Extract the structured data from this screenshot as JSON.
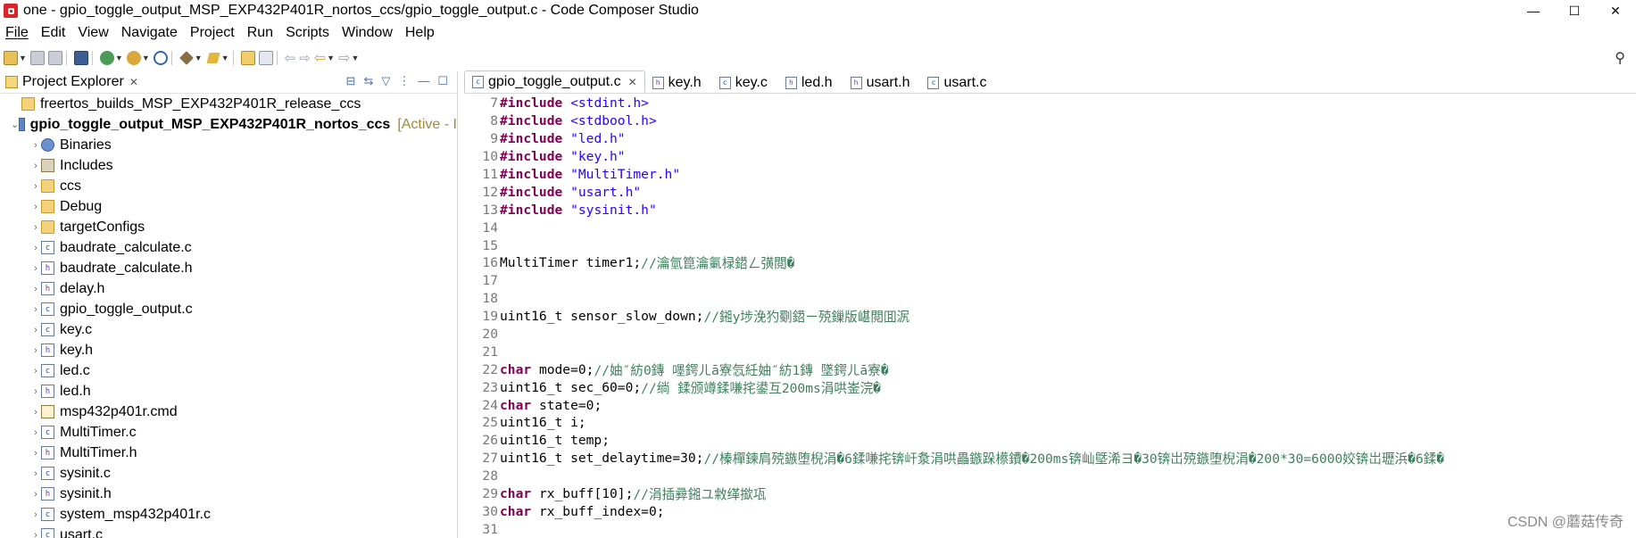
{
  "window": {
    "title": "one - gpio_toggle_output_MSP_EXP432P401R_nortos_ccs/gpio_toggle_output.c - Code Composer Studio",
    "controls": [
      "—",
      "☐",
      "✕"
    ]
  },
  "menu": [
    "File",
    "Edit",
    "View",
    "Navigate",
    "Project",
    "Run",
    "Scripts",
    "Window",
    "Help"
  ],
  "project_explorer": {
    "title": "Project Explorer",
    "close": "✕",
    "tools": [
      "⊟",
      "⇆",
      "▽",
      "⋮",
      "—",
      "☐"
    ],
    "items": [
      {
        "label": "freertos_builds_MSP_EXP432P401R_release_ccs",
        "icon": "folder-icon",
        "twisty": "",
        "bold": false
      },
      {
        "label": "gpio_toggle_output_MSP_EXP432P401R_nortos_ccs",
        "icon": "project-icon",
        "twisty": "⌄",
        "bold": true,
        "tag": "[Active - I"
      },
      {
        "label": "Binaries",
        "icon": "binaries-icon",
        "twisty": "›"
      },
      {
        "label": "Includes",
        "icon": "includes-icon",
        "twisty": "›"
      },
      {
        "label": "ccs",
        "icon": "folder-icon",
        "twisty": "›"
      },
      {
        "label": "Debug",
        "icon": "folder-icon",
        "twisty": "›"
      },
      {
        "label": "targetConfigs",
        "icon": "folder-icon",
        "twisty": "›"
      },
      {
        "label": "baudrate_calculate.c",
        "icon": "c-file-icon",
        "twisty": "›"
      },
      {
        "label": "baudrate_calculate.h",
        "icon": "h-file-icon",
        "twisty": "›"
      },
      {
        "label": "delay.h",
        "icon": "h-file-icon",
        "twisty": "›"
      },
      {
        "label": "gpio_toggle_output.c",
        "icon": "c-file-icon",
        "twisty": "›"
      },
      {
        "label": "key.c",
        "icon": "c-file-icon",
        "twisty": "›"
      },
      {
        "label": "key.h",
        "icon": "h-file-icon",
        "twisty": "›"
      },
      {
        "label": "led.c",
        "icon": "c-file-icon",
        "twisty": "›"
      },
      {
        "label": "led.h",
        "icon": "h-file-icon",
        "twisty": "›"
      },
      {
        "label": "msp432p401r.cmd",
        "icon": "cmd-file-icon",
        "twisty": "›"
      },
      {
        "label": "MultiTimer.c",
        "icon": "c-file-icon",
        "twisty": "›"
      },
      {
        "label": "MultiTimer.h",
        "icon": "h-file-icon",
        "twisty": "›"
      },
      {
        "label": "sysinit.c",
        "icon": "c-file-icon",
        "twisty": "›"
      },
      {
        "label": "sysinit.h",
        "icon": "h-file-icon",
        "twisty": "›"
      },
      {
        "label": "system_msp432p401r.c",
        "icon": "c-file-icon",
        "twisty": "›"
      },
      {
        "label": "usart.c",
        "icon": "c-file-icon",
        "twisty": "›"
      }
    ]
  },
  "editor": {
    "tabs": [
      {
        "label": "gpio_toggle_output.c",
        "active": true,
        "close": "✕"
      },
      {
        "label": "key.h"
      },
      {
        "label": "key.c"
      },
      {
        "label": "led.h"
      },
      {
        "label": "usart.h"
      },
      {
        "label": "usart.c"
      }
    ],
    "lines": [
      {
        "n": "7",
        "parts": [
          [
            "kw",
            "#include"
          ],
          [
            "pl",
            " "
          ],
          [
            "str",
            "<stdint.h>"
          ]
        ]
      },
      {
        "n": "8",
        "parts": [
          [
            "kw",
            "#include"
          ],
          [
            "pl",
            " "
          ],
          [
            "str",
            "<stdbool.h>"
          ]
        ]
      },
      {
        "n": "9",
        "parts": [
          [
            "kw",
            "#include"
          ],
          [
            "pl",
            " "
          ],
          [
            "str",
            "\"led.h\""
          ]
        ]
      },
      {
        "n": "10",
        "parts": [
          [
            "kw",
            "#include"
          ],
          [
            "pl",
            " "
          ],
          [
            "str",
            "\"key.h\""
          ]
        ]
      },
      {
        "n": "11",
        "parts": [
          [
            "kw",
            "#include"
          ],
          [
            "pl",
            " "
          ],
          [
            "str",
            "\"MultiTimer.h\""
          ]
        ]
      },
      {
        "n": "12",
        "parts": [
          [
            "kw",
            "#include"
          ],
          [
            "pl",
            " "
          ],
          [
            "str",
            "\"usart.h\""
          ]
        ]
      },
      {
        "n": "13",
        "parts": [
          [
            "kw",
            "#include"
          ],
          [
            "pl",
            " "
          ],
          [
            "str",
            "\"sysinit.h\""
          ]
        ]
      },
      {
        "n": "14",
        "parts": []
      },
      {
        "n": "15",
        "parts": []
      },
      {
        "n": "16",
        "parts": [
          [
            "pl",
            "MultiTimer timer1;"
          ],
          [
            "cm",
            "//瀹氫箟瀹氭椂鍣ㄥ彉閲�"
          ]
        ]
      },
      {
        "n": "17",
        "parts": []
      },
      {
        "n": "18",
        "parts": []
      },
      {
        "n": "19",
        "parts": [
          [
            "pl",
            "uint16_t sensor_slow_down;"
          ],
          [
            "cm",
            "//鎺у埗浼犳劅鍣ㄧ殑鏁版嵁閲囬泦"
          ]
        ]
      },
      {
        "n": "20",
        "parts": []
      },
      {
        "n": "21",
        "parts": []
      },
      {
        "n": "22",
        "parts": [
          [
            "kw",
            "char"
          ],
          [
            "pl",
            " mode=0;"
          ],
          [
            "cm",
            "//妯″紡0鏄 嚜鍔ㄦā寮忥紝妯″紡1鏄 墜鍔ㄦā寮�"
          ]
        ]
      },
      {
        "n": "23",
        "parts": [
          [
            "pl",
            "uint16_t sec_60=0;"
          ],
          [
            "cm",
            "//绱 鍒颁竴鍒嗛挓鍙互200ms涓哄崟浣�"
          ]
        ]
      },
      {
        "n": "24",
        "parts": [
          [
            "kw",
            "char"
          ],
          [
            "pl",
            " state=0;"
          ]
        ]
      },
      {
        "n": "25",
        "parts": [
          [
            "pl",
            "uint16_t i;"
          ]
        ]
      },
      {
        "n": "26",
        "parts": [
          [
            "pl",
            "uint16_t temp;"
          ]
        ]
      },
      {
        "n": "27",
        "parts": [
          [
            "pl",
            "uint16_t set_delaytime=30;"
          ],
          [
            "cm",
            "//榛樿鍊肩殑鏃堕棿涓�6鍒嗛挓锛屽洜涓哄畾鏃跺櫒鐨�200ms锛屾墍浠ヨ�30锛岀殑鏃堕棿涓�200*30=6000姣锛岀瓑浜�6鍒�"
          ]
        ]
      },
      {
        "n": "28",
        "parts": []
      },
      {
        "n": "29",
        "parts": [
          [
            "kw",
            "char"
          ],
          [
            "pl",
            " rx_buff[10];"
          ],
          [
            "cm",
            "//涓插彛鎺ユ敹缂撳瓨"
          ]
        ]
      },
      {
        "n": "30",
        "parts": [
          [
            "kw",
            "char"
          ],
          [
            "pl",
            " rx_buff_index=0;"
          ]
        ]
      },
      {
        "n": "31",
        "parts": []
      }
    ]
  },
  "watermark": "CSDN @蘑菇传奇"
}
